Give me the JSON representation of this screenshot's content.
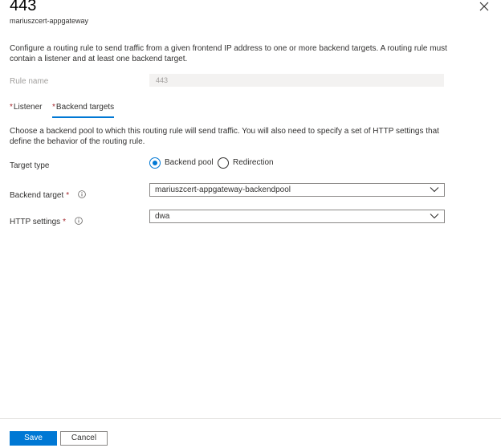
{
  "header": {
    "title": "443",
    "subtitle": "mariuszcert-appgateway"
  },
  "description": "Configure a routing rule to send traffic from a given frontend IP address to one or more backend targets. A routing rule must contain a listener and at least one backend target.",
  "rule_name": {
    "label": "Rule name",
    "value": "443"
  },
  "tabs": [
    {
      "label": "Listener",
      "required": "*",
      "active": false
    },
    {
      "label": "Backend targets",
      "required": "*",
      "active": true
    }
  ],
  "backend_targets": {
    "description": "Choose a backend pool to which this routing rule will send traffic. You will also need to specify a set of HTTP settings that define the behavior of the routing rule.",
    "target_type": {
      "label": "Target type",
      "options": [
        {
          "label": "Backend pool",
          "selected": true
        },
        {
          "label": "Redirection",
          "selected": false
        }
      ]
    },
    "backend_target": {
      "label": "Backend target",
      "required": "*",
      "value": "mariuszcert-appgateway-backendpool"
    },
    "http_settings": {
      "label": "HTTP settings",
      "required": "*",
      "value": "dwa"
    }
  },
  "footer": {
    "save_label": "Save",
    "cancel_label": "Cancel"
  },
  "colors": {
    "accent": "#0078d4",
    "required": "#a4262c",
    "disabled_text": "#a19f9d"
  },
  "icons": {
    "close": "close-icon",
    "info": "info-icon",
    "dropdown": "chevron-down-icon"
  }
}
